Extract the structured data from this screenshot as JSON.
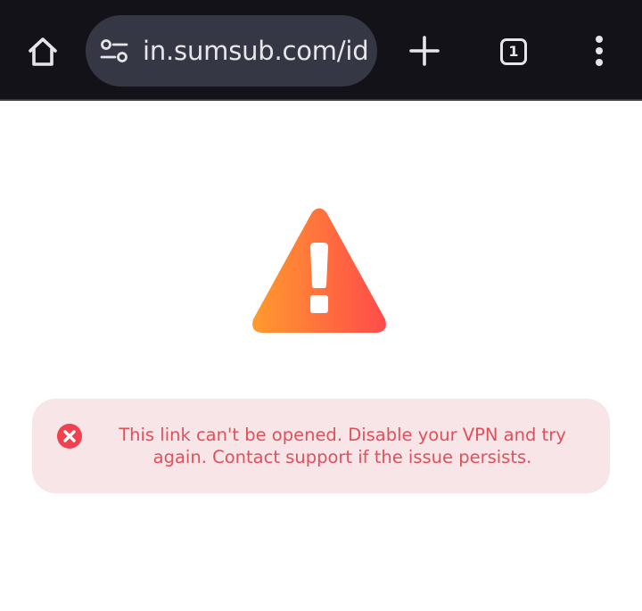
{
  "browser": {
    "url": "in.sumsub.com/id",
    "tab_count": "1",
    "icons": {
      "home": "home-icon",
      "site_settings": "tune-icon",
      "new_tab": "plus-icon",
      "tab_switcher": "tab-count-icon",
      "menu": "more-vertical-icon"
    },
    "colors": {
      "toolbar_bg": "#131218",
      "omnibox_bg": "#363744",
      "icon_fg": "#e6e6ea"
    }
  },
  "page": {
    "warning_icon": "warning-triangle-icon",
    "error": {
      "icon": "error-circle-x-icon",
      "message": "This link can't be opened. Disable your VPN and try again. Contact support if the issue persists."
    },
    "colors": {
      "warning_gradient_start": "#ff9a2e",
      "warning_gradient_end": "#ff4b4b",
      "error_bg": "#f8e5e7",
      "error_text": "#e0505c",
      "error_icon": "#f0414e"
    }
  }
}
